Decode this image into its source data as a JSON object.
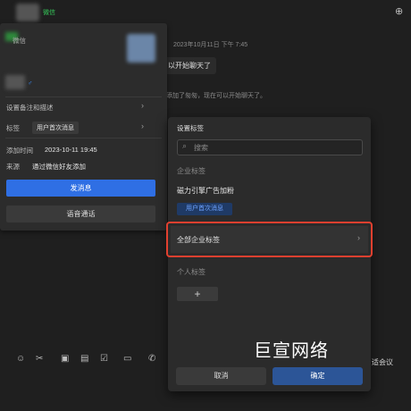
{
  "header": {
    "channel_tag": "微信",
    "add_icon": "add-contact-icon"
  },
  "chat": {
    "timestamp": "2023年10月11日 下午 7:45",
    "message": "以开始聊天了",
    "system_notice": "添加了匆匆，现在可以开始聊天了。"
  },
  "card": {
    "source_app": "微信",
    "set_remark_label": "设置备注和描述",
    "tag_label": "标签",
    "tag_value": "用户首次消息",
    "added_time_label": "添加时间",
    "added_time_value": "2023-10-11 19:45",
    "source_label": "来源",
    "source_value": "通过微信好友添加",
    "send_message_button": "发消息",
    "voice_call_button": "语音通话"
  },
  "dialog": {
    "title": "设置标签",
    "search_placeholder": "搜索",
    "enterprise_section": "企业标签",
    "group_name": "磁力引擎广告加粉",
    "selected_tag": "用户首次消息",
    "all_enterprise_tags": "全部企业标签",
    "personal_section": "个人标签",
    "add_symbol": "+",
    "cancel_button": "取消",
    "confirm_button": "确定"
  },
  "watermark": "巨宣网络",
  "toolbar": {
    "meeting_label": "适会议"
  },
  "colors": {
    "accent_blue": "#2f6fe4",
    "highlight_red": "#e1402f",
    "tag_blue_text": "#6ea3ff",
    "wechat_green": "#35c759"
  }
}
